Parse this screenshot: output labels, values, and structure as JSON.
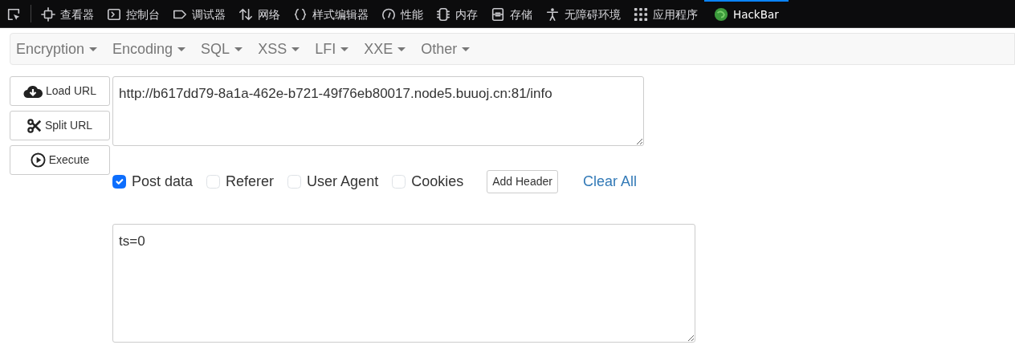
{
  "devtools_tabs": [
    {
      "selected": false
    },
    {
      "label": "查看器",
      "selected": false
    },
    {
      "label": "控制台",
      "selected": false
    },
    {
      "label": "调试器",
      "selected": false
    },
    {
      "label": "网络",
      "selected": false
    },
    {
      "label": "样式编辑器",
      "selected": false
    },
    {
      "label": "性能",
      "selected": false
    },
    {
      "label": "内存",
      "selected": false
    },
    {
      "label": "存储",
      "selected": false
    },
    {
      "label": "无障碍环境",
      "selected": false
    },
    {
      "label": "应用程序",
      "selected": false
    },
    {
      "label": "HackBar",
      "selected": true
    }
  ],
  "menu": [
    "Encryption",
    "Encoding",
    "SQL",
    "XSS",
    "LFI",
    "XXE",
    "Other"
  ],
  "actions": [
    "Load URL",
    "Split URL",
    "Execute"
  ],
  "url": {
    "value": "http://b617dd79-8a1a-462e-b721-49f76eb80017.node5.buuoj.cn:81/info"
  },
  "options": [
    {
      "label": "Post data",
      "checked": true
    },
    {
      "label": "Referer",
      "checked": false
    },
    {
      "label": "User Agent",
      "checked": false
    },
    {
      "label": "Cookies",
      "checked": false
    }
  ],
  "add_header": "Add Header",
  "clear_all": "Clear All",
  "post_body": {
    "value": "ts=0"
  }
}
